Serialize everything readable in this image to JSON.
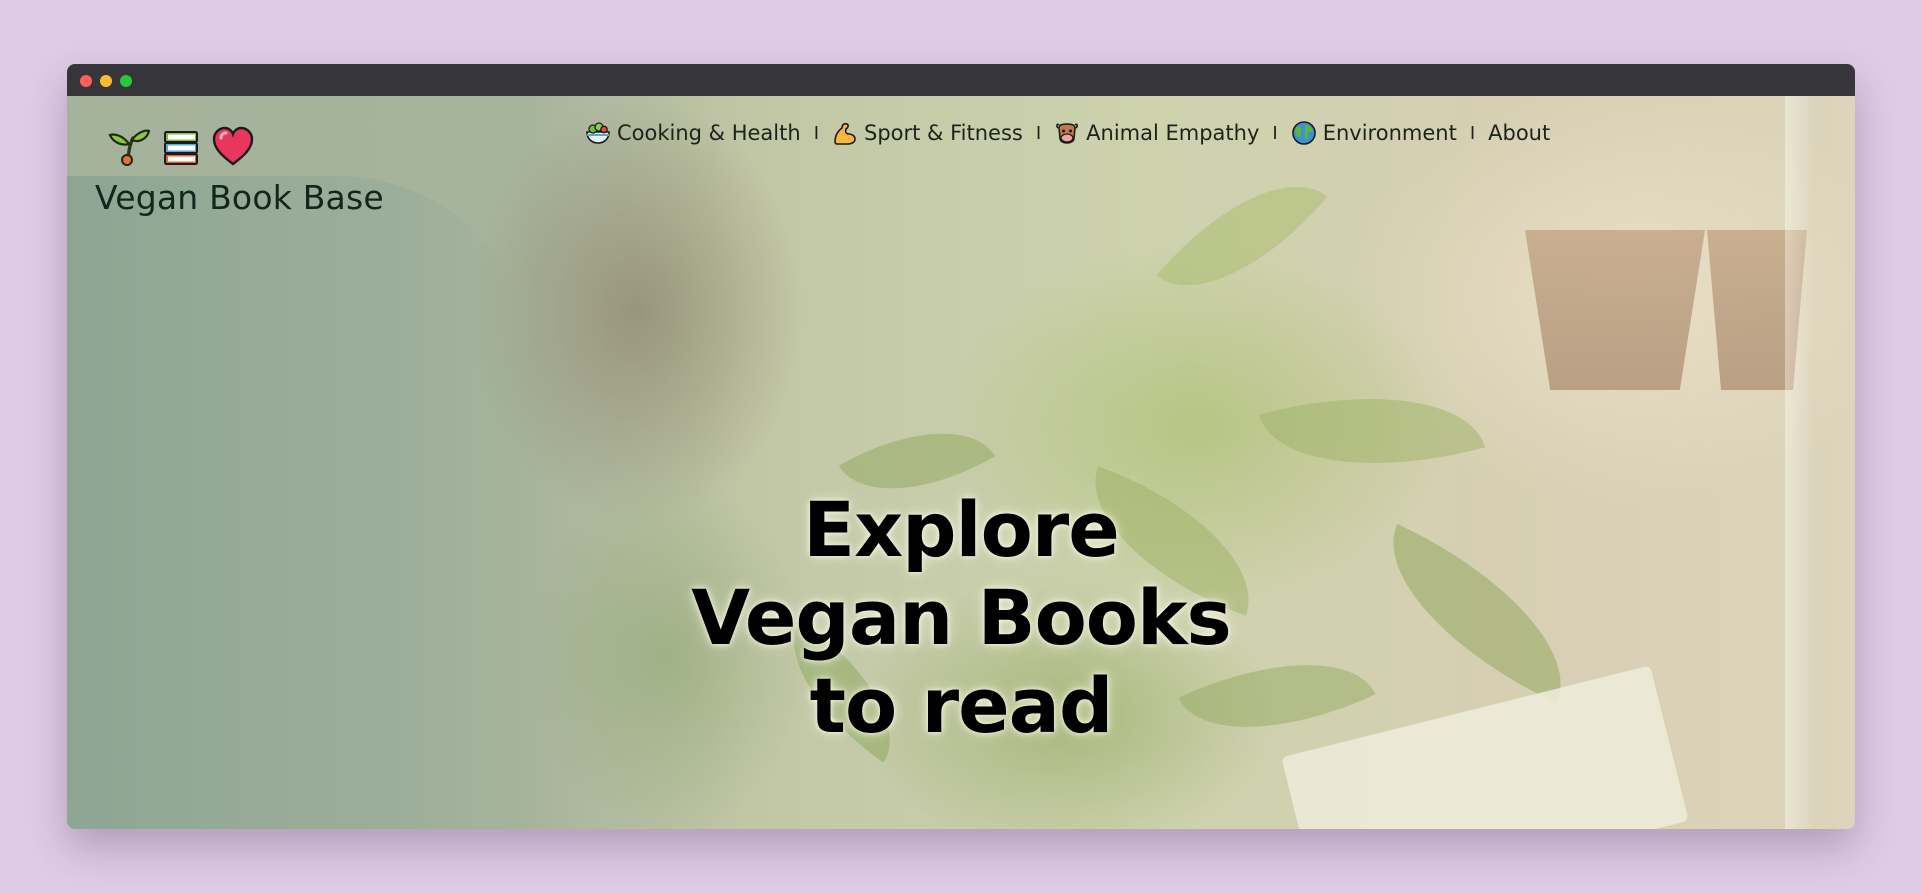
{
  "window": {
    "traffic_lights": [
      "#fe5f57",
      "#febb2e",
      "#28c840"
    ]
  },
  "site": {
    "logo_icons": [
      "seedling-icon",
      "books-icon",
      "heart-icon"
    ],
    "brand": "Vegan Book Base"
  },
  "nav": {
    "separator": "I",
    "items": [
      {
        "icon": "salad-icon",
        "label": "Cooking & Health"
      },
      {
        "icon": "flexed-arm-icon",
        "label": "Sport & Fitness"
      },
      {
        "icon": "cow-icon",
        "label": "Animal Empathy"
      },
      {
        "icon": "globe-icon",
        "label": "Environment"
      },
      {
        "label": "About"
      }
    ]
  },
  "hero": {
    "lines": [
      "Explore",
      "Vegan Books",
      "to read"
    ]
  }
}
